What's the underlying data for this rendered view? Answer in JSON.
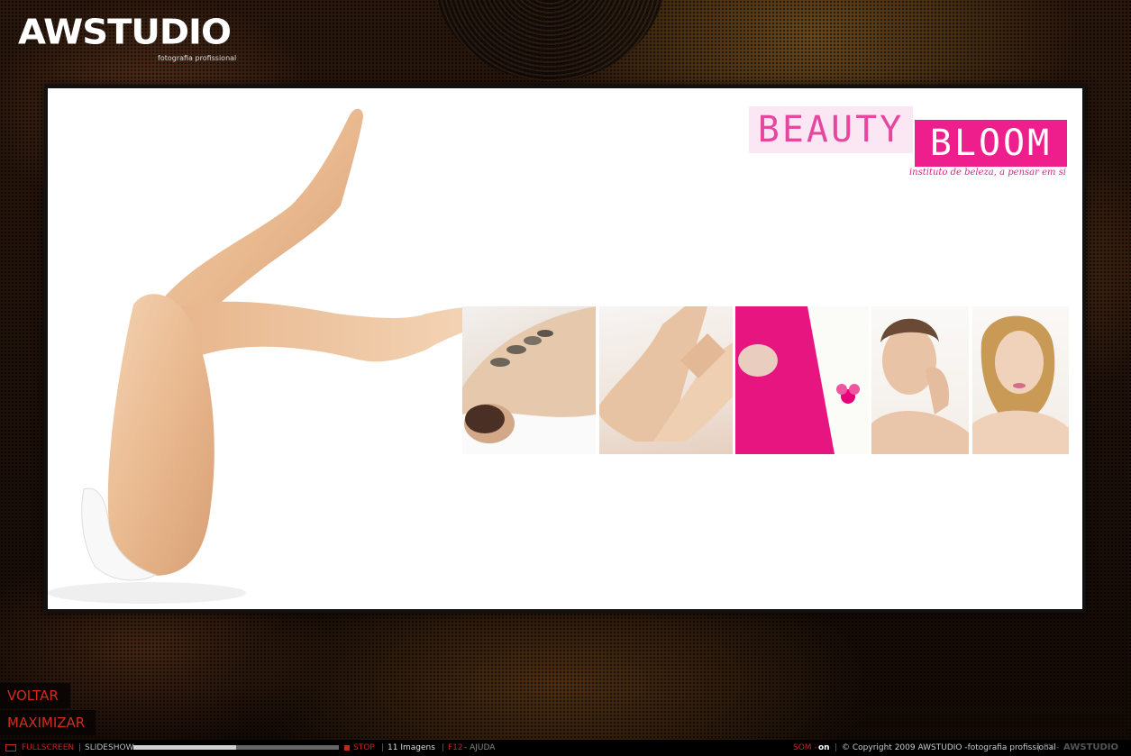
{
  "logo": {
    "name": "AWSTUDIO",
    "subtitle": "fotografia profissional"
  },
  "brand": {
    "word1": "BEAUTY",
    "word2": "BLOOM",
    "tagline": "instituto de beleza, a pensar em si"
  },
  "side_buttons": {
    "back": "VOLTAR",
    "maximize": "MAXIMIZAR"
  },
  "bottom_bar": {
    "fullscreen": "FULLSCREEN",
    "slideshow": "SLIDESHOW",
    "slideshow_progress": 0.5,
    "stop": "STOP",
    "images_count": "11 Imagens",
    "help_key": "F12",
    "help_label": "- AJUDA",
    "sound_label": "SOM -",
    "sound_value": "on",
    "copyright": "© Copyright 2009 AWSTUDIO -fotografia profissional",
    "by_label": "BY -",
    "by_logo": "AWSTUDIO"
  },
  "colors": {
    "accent_red": "#c9231a",
    "brand_pink": "#ee1e8c",
    "brand_pink_light": "#fbe7f3"
  },
  "thumbnails": [
    {
      "name": "hot-stone-massage-photo"
    },
    {
      "name": "feet-care-photo"
    },
    {
      "name": "pink-towel-spa-photo"
    },
    {
      "name": "facial-care-photo"
    },
    {
      "name": "woman-portrait-photo"
    }
  ]
}
